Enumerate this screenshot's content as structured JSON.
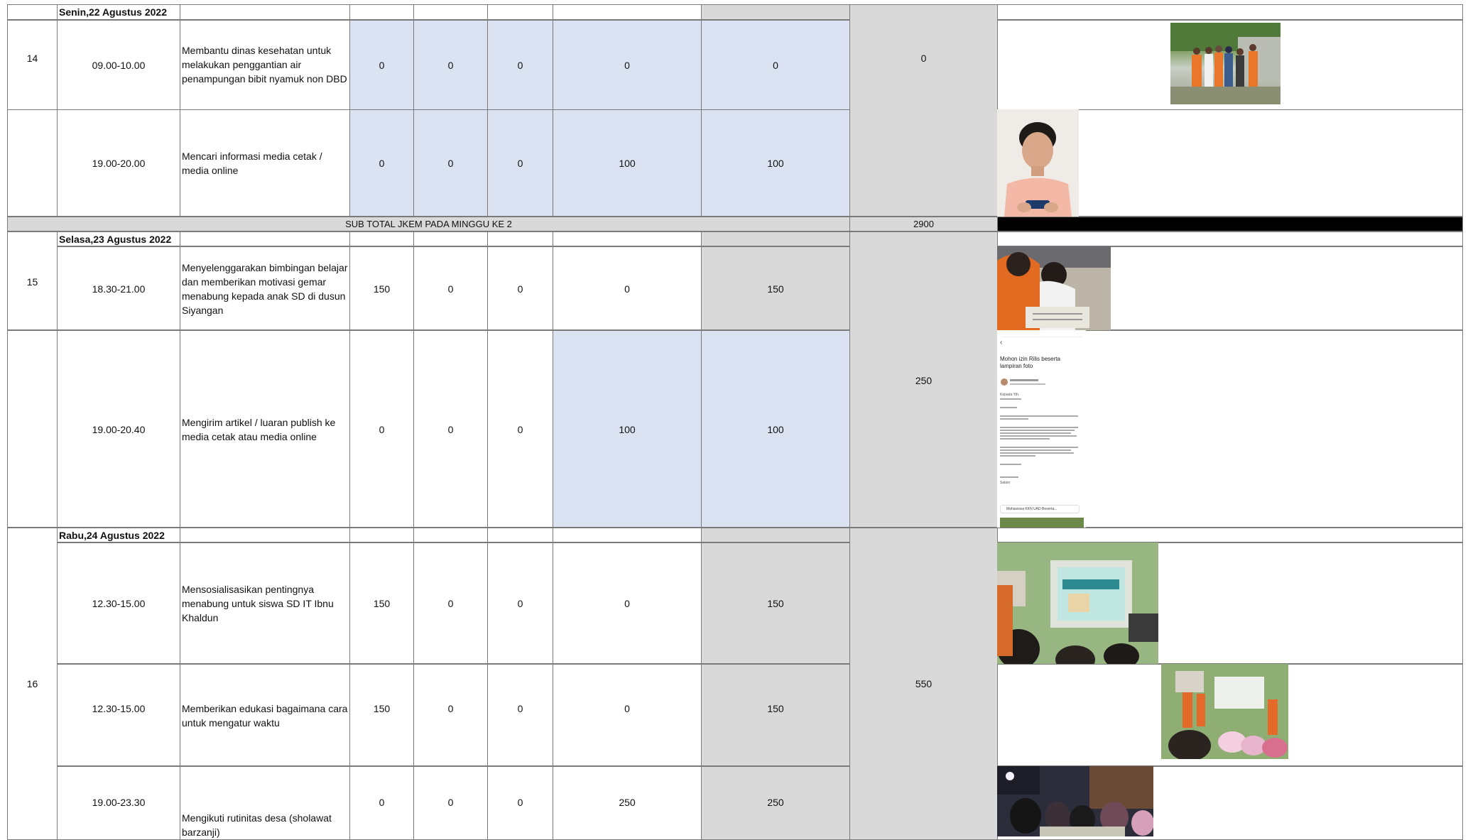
{
  "sections": [
    {
      "date": "Senin,22 Agustus 2022"
    },
    {
      "date": "Selasa,23 Agustus 2022"
    },
    {
      "date": "Rabu,24 Agustus 2022"
    }
  ],
  "rows": [
    {
      "no": "14",
      "time": "09.00-10.00",
      "activity": "Membantu dinas kesehatan untuk melakukan penggantian air penampungan bibit nyamuk non DBD",
      "v1": "0",
      "v2": "0",
      "v3": "0",
      "v4": "0",
      "v5": "0"
    },
    {
      "no": "",
      "time": "19.00-20.00",
      "activity": "Mencari informasi media cetak / media online",
      "v1": "0",
      "v2": "0",
      "v3": "0",
      "v4": "100",
      "v5": "100"
    },
    {
      "no": "15",
      "time": "18.30-21.00",
      "activity": "Menyelenggarakan bimbingan belajar  dan  memberikan motivasi gemar menabung kepada anak SD di dusun Siyangan",
      "v1": "150",
      "v2": "0",
      "v3": "0",
      "v4": "0",
      "v5": "150"
    },
    {
      "no": "",
      "time": "19.00-20.40",
      "activity": "Mengirim artikel / luaran publish ke media cetak atau media online",
      "v1": "0",
      "v2": "0",
      "v3": "0",
      "v4": "100",
      "v5": "100"
    },
    {
      "no": "16",
      "time": "12.30-15.00",
      "activity": "Mensosialisasikan pentingnya menabung untuk siswa SD IT Ibnu Khaldun",
      "v1": "150",
      "v2": "0",
      "v3": "0",
      "v4": "0",
      "v5": "150"
    },
    {
      "no": "",
      "time": "12.30-15.00",
      "activity": "Memberikan edukasi bagaimana cara untuk mengatur waktu",
      "v1": "150",
      "v2": "0",
      "v3": "0",
      "v4": "0",
      "v5": "150"
    },
    {
      "no": "",
      "time": "19.00-23.30",
      "activity": "Mengikuti rutinitas desa (sholawat barzanji)",
      "v1": "0",
      "v2": "0",
      "v3": "0",
      "v4": "250",
      "v5": "250"
    }
  ],
  "daily_totals": {
    "day1": "0",
    "day2": "250",
    "day3": "550"
  },
  "subtotal": {
    "label": "SUB TOTAL JKEM PADA MINGGU KE 2",
    "value": "2900"
  },
  "email_photo": {
    "subject": "Mohon izin Rilis beserta lampiran foto",
    "greeting": "Kepada Yth.",
    "signoff": "Salam",
    "attachment": "Mahasiswa KKN UAD Beserta..."
  },
  "photos": {
    "p1": "group-photo",
    "p2": "student-phone-photo",
    "p3": "tutoring-photo",
    "p4": "email-screenshot",
    "p5": "classroom-projector-photo",
    "p6": "classroom-photo",
    "p7": "evening-gathering-photo"
  }
}
